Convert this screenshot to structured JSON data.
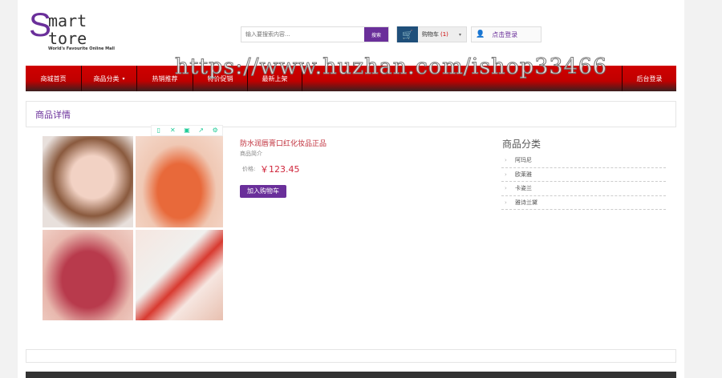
{
  "logo": {
    "s1": "S",
    "t1": "mart",
    "s2": "S",
    "t2": "tore",
    "tagline": "World's Favourite Online Mall"
  },
  "search": {
    "placeholder": "输入要搜索内容...",
    "button": "搜索"
  },
  "cart": {
    "label": "购物车",
    "count": "(1)"
  },
  "login": "点击登录",
  "nav": [
    "商城首页",
    "商品分类",
    "热销推荐",
    "特价促销",
    "最新上架"
  ],
  "nav_right": "后台登录",
  "watermark": "https://www.huzhan.com/ishop33466",
  "section_title": "商品详情",
  "product": {
    "name": "防水润唇膏口红化妆品正品",
    "intro": "商品简介",
    "price_label": "价格:",
    "price": "￥123.45",
    "add_cart": "加入购物车"
  },
  "sidebar": {
    "title": "商品分类",
    "items": [
      "阿玛尼",
      "欧莱雅",
      "卡姿兰",
      "雅诗兰黛"
    ]
  },
  "colors": {
    "brand": "#6a2f9a",
    "nav": "#c00000",
    "price": "#d0263c"
  }
}
